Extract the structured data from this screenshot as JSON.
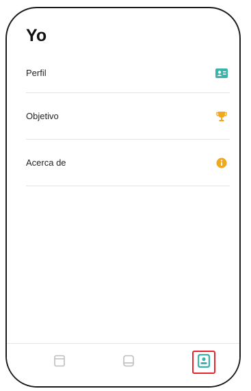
{
  "page": {
    "title": "Yo"
  },
  "menu": {
    "items": [
      {
        "label": "Perfil",
        "icon": "profile-card-icon",
        "icon_color": "#3ab3ad"
      },
      {
        "label": "Objetivo",
        "icon": "trophy-icon",
        "icon_color": "#f0a91e"
      },
      {
        "label": "Acerca de",
        "icon": "info-icon",
        "icon_color": "#f0a91e"
      }
    ]
  },
  "tabbar": {
    "tabs": [
      {
        "icon": "calendar-icon",
        "active": false
      },
      {
        "icon": "device-icon",
        "active": false
      },
      {
        "icon": "person-icon",
        "active": true
      }
    ],
    "active_color": "#3ab3ad",
    "inactive_color": "#bdbdbd",
    "highlight_color": "#e8232c"
  }
}
